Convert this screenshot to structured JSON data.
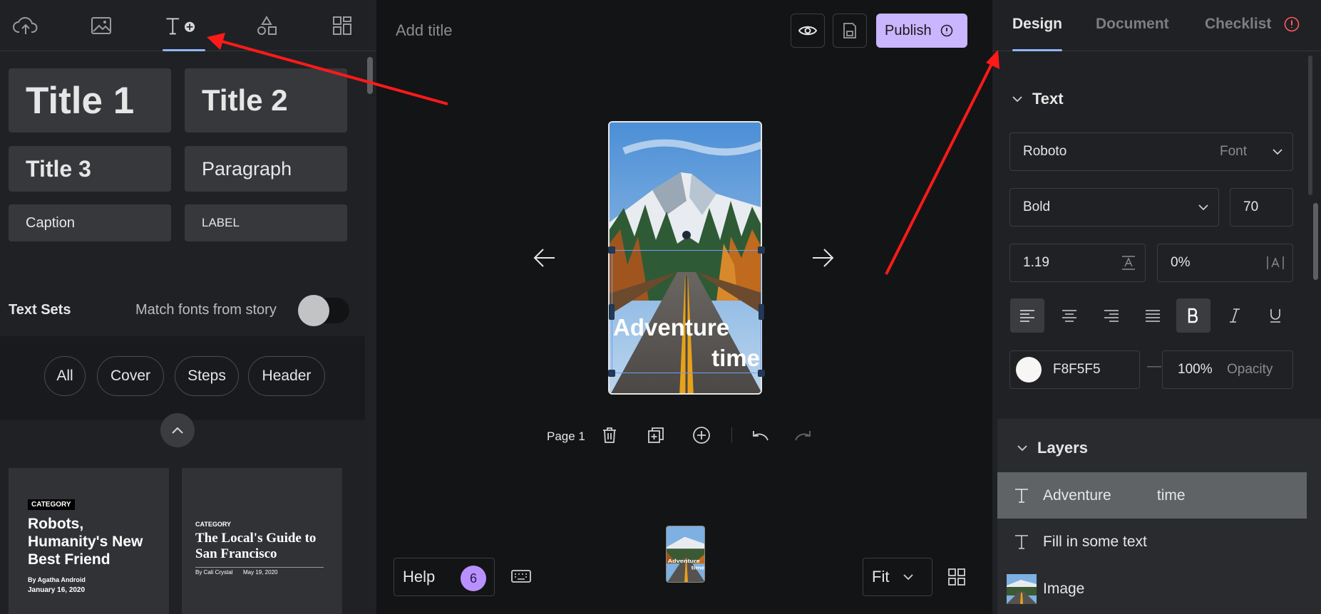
{
  "left_panel": {
    "tabs": [
      "upload",
      "media",
      "text",
      "shapes",
      "templates"
    ],
    "presets": [
      {
        "label": "Title 1"
      },
      {
        "label": "Title 2"
      },
      {
        "label": "Title 3"
      },
      {
        "label": "Paragraph"
      },
      {
        "label": "Caption"
      },
      {
        "label": "LABEL"
      }
    ],
    "text_sets_title": "Text Sets",
    "match_fonts_label": "Match fonts from story",
    "chips": [
      "All",
      "Cover",
      "Steps",
      "Header"
    ],
    "card1": {
      "category": "CATEGORY",
      "headline": "Robots, Humanity's New Best Friend",
      "byline": "By Agatha Android",
      "date": "January 16, 2020"
    },
    "card2": {
      "category": "CATEGORY",
      "headline": "The Local's Guide to San Francisco",
      "byline": "By Cali Crystal",
      "date": "May 19, 2020"
    }
  },
  "header": {
    "add_title_placeholder": "Add title",
    "publish_label": "Publish"
  },
  "canvas": {
    "text_line1": "Adventure",
    "text_line2": "time",
    "thumb_line1": "Adventure",
    "thumb_line2": "time"
  },
  "page_controls": {
    "page_label": "Page 1"
  },
  "footer": {
    "help_label": "Help",
    "help_badge": "6",
    "zoom_label": "Fit"
  },
  "right_panel": {
    "tabs": {
      "design": "Design",
      "document": "Document",
      "checklist": "Checklist"
    },
    "text_section_title": "Text",
    "font_name": "Roboto",
    "font_label": "Font",
    "font_weight": "Bold",
    "font_size": "70",
    "line_height": "1.19",
    "letter_spacing": "0%",
    "color_hex": "F8F5F5",
    "opacity_value": "100%",
    "opacity_label": "Opacity",
    "layers_title": "Layers",
    "layers": [
      {
        "name": "Adventure           time",
        "type": "text"
      },
      {
        "name": "Fill in some text",
        "type": "text"
      },
      {
        "name": "Image",
        "type": "image"
      }
    ]
  },
  "colors": {
    "accent": "#8fb4ff",
    "publish": "#cab5ff",
    "badge": "#b990ff",
    "annotation_arrow": "#ff1a1a",
    "checklist_warning": "#ff5b5b"
  }
}
